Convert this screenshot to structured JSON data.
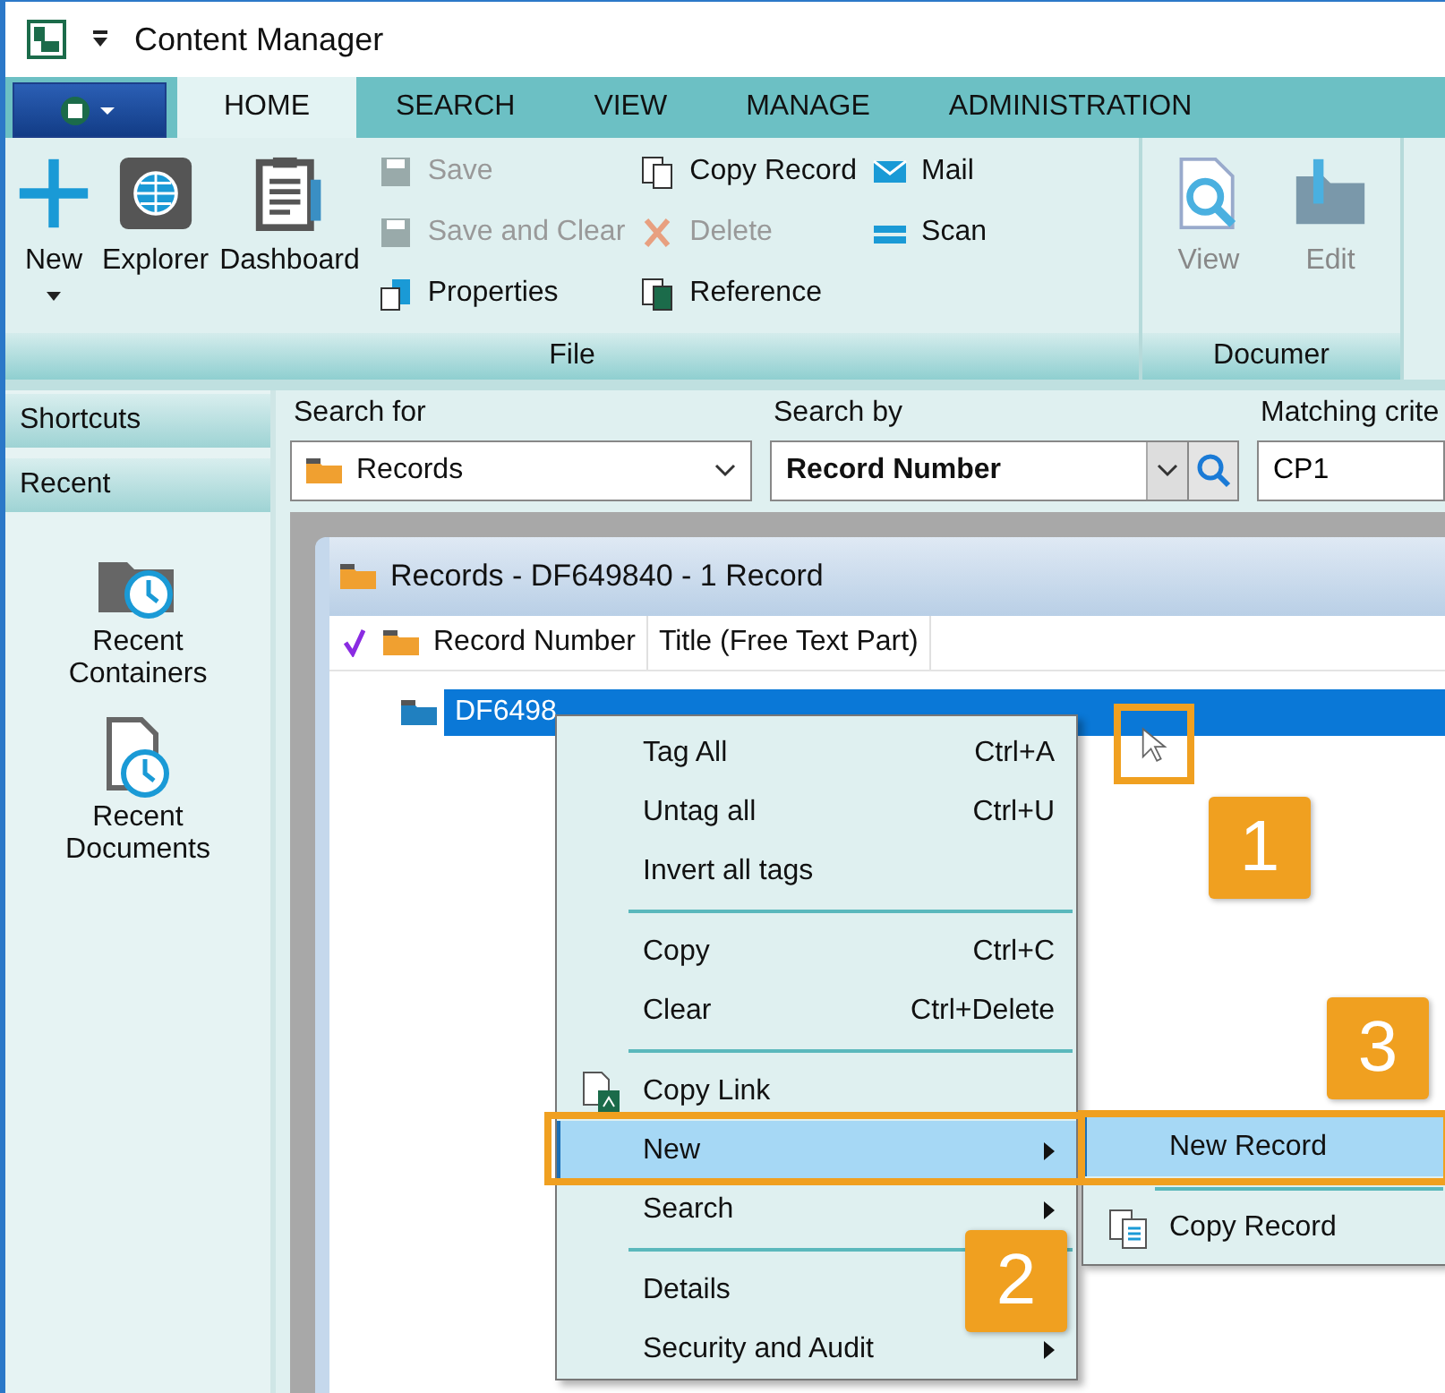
{
  "window": {
    "title": "Content Manager"
  },
  "ribbon": {
    "tabs": [
      {
        "label": "HOME",
        "selected": true
      },
      {
        "label": "SEARCH",
        "selected": false
      },
      {
        "label": "VIEW",
        "selected": false
      },
      {
        "label": "MANAGE",
        "selected": false
      },
      {
        "label": "ADMINISTRATION",
        "selected": false
      }
    ],
    "groups": [
      {
        "label": "File",
        "large_buttons": [
          {
            "label": "New",
            "dropdown": true,
            "disabled": false
          },
          {
            "label": "Explorer",
            "dropdown": false,
            "disabled": false
          },
          {
            "label": "Dashboard",
            "dropdown": false,
            "disabled": false
          }
        ],
        "small_columns": [
          [
            {
              "label": "Save",
              "disabled": true
            },
            {
              "label": "Save and Clear",
              "disabled": true
            },
            {
              "label": "Properties",
              "disabled": false
            }
          ],
          [
            {
              "label": "Copy Record",
              "disabled": false
            },
            {
              "label": "Delete",
              "disabled": true
            },
            {
              "label": "Reference",
              "disabled": false
            }
          ],
          [
            {
              "label": "Mail",
              "disabled": false
            },
            {
              "label": "Scan",
              "disabled": false
            }
          ]
        ]
      },
      {
        "label": "Documer",
        "large_buttons": [
          {
            "label": "View",
            "dropdown": false,
            "disabled": true
          },
          {
            "label": "Edit",
            "dropdown": false,
            "disabled": true
          }
        ]
      }
    ]
  },
  "sidebar": {
    "headers": [
      "Shortcuts",
      "Recent"
    ],
    "items": [
      {
        "label": "Recent Containers"
      },
      {
        "label": "Recent Documents"
      }
    ]
  },
  "search": {
    "search_for": {
      "label": "Search for",
      "value": "Records"
    },
    "search_by": {
      "label": "Search by",
      "value": "Record Number"
    },
    "matching": {
      "label": "Matching crite",
      "value": "CP1"
    }
  },
  "results": {
    "title": "Records - DF649840 - 1 Record",
    "columns": [
      "Record Number",
      "Title (Free Text Part)"
    ],
    "rows": [
      {
        "record_number": "DF6498",
        "selected": true
      }
    ]
  },
  "context_menu": [
    {
      "kind": "item",
      "label": "Tag All",
      "shortcut": "Ctrl+A",
      "icon": false,
      "submenu": false,
      "selected": false
    },
    {
      "kind": "item",
      "label": "Untag all",
      "shortcut": "Ctrl+U",
      "icon": false,
      "submenu": false,
      "selected": false
    },
    {
      "kind": "item",
      "label": "Invert all tags",
      "icon": false,
      "submenu": false,
      "selected": false
    },
    {
      "kind": "separator"
    },
    {
      "kind": "item",
      "label": "Copy",
      "shortcut": "Ctrl+C",
      "icon": false,
      "submenu": false,
      "selected": false
    },
    {
      "kind": "item",
      "label": "Clear",
      "shortcut": "Ctrl+Delete",
      "icon": false,
      "submenu": false,
      "selected": false
    },
    {
      "kind": "separator"
    },
    {
      "kind": "item",
      "label": "Copy Link",
      "icon": true,
      "submenu": false,
      "selected": false
    },
    {
      "kind": "item",
      "label": "New",
      "icon": false,
      "submenu": true,
      "selected": true
    },
    {
      "kind": "item",
      "label": "Search",
      "icon": false,
      "submenu": true,
      "selected": false
    },
    {
      "kind": "separator"
    },
    {
      "kind": "item",
      "label": "Details",
      "icon": false,
      "submenu": false,
      "selected": false
    },
    {
      "kind": "item",
      "label": "Security and Audit",
      "icon": false,
      "submenu": true,
      "selected": false
    }
  ],
  "submenu": [
    {
      "kind": "item",
      "label": "New Record",
      "icon": false,
      "selected": true
    },
    {
      "kind": "separator"
    },
    {
      "kind": "item",
      "label": "Copy Record",
      "icon": true,
      "selected": false
    }
  ],
  "callouts": [
    {
      "label": "1"
    },
    {
      "label": "2"
    },
    {
      "label": "3"
    }
  ]
}
